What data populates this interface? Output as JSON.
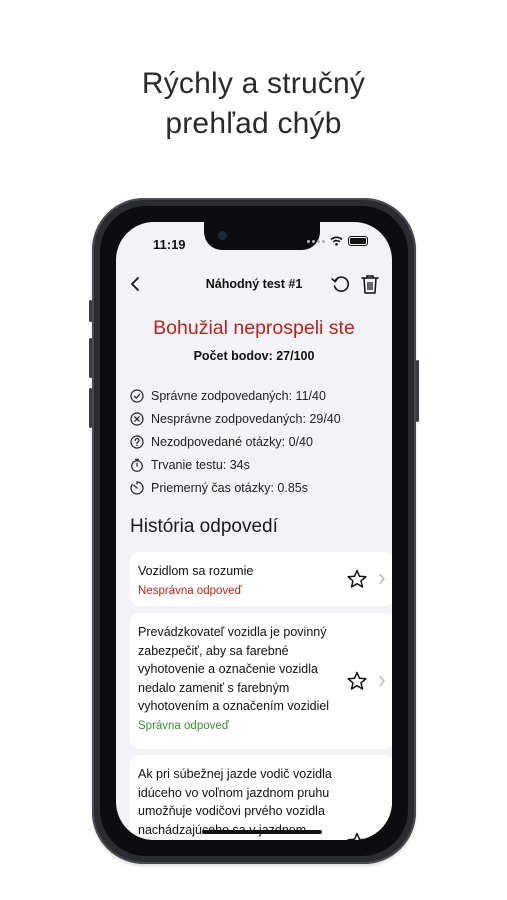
{
  "headline": {
    "line1": "Rýchly a stručný",
    "line2": "prehľad chýb"
  },
  "status_bar": {
    "time": "11:19"
  },
  "nav": {
    "title": "Náhodný test #1"
  },
  "result": {
    "title": "Bohužial neprospeli ste",
    "score": "Počet bodov: 27/100"
  },
  "stats": [
    {
      "icon": "check-circle-icon",
      "text": "Správne zodpovedaných: 11/40"
    },
    {
      "icon": "x-circle-icon",
      "text": "Nesprávne zodpovedaných: 29/40"
    },
    {
      "icon": "question-circle-icon",
      "text": "Nezodpovedané otázky: 0/40"
    },
    {
      "icon": "stopwatch-icon",
      "text": "Trvanie testu: 34s"
    },
    {
      "icon": "timer-icon",
      "text": "Priemerný čas otázky: 0.85s"
    }
  ],
  "history": {
    "title": "História odpovedí",
    "items": [
      {
        "question": "Vozidlom sa rozumie",
        "status": "Nesprávna odpoveď",
        "correct": false
      },
      {
        "question": "Prevádzkovateľ vozidla je povinný zabezpečiť, aby sa farebné vyhotovenie a označenie vozidla nedalo zameniť s farebným vyhotovením a označením vozidiel",
        "status": "Správna odpoveď",
        "correct": true
      },
      {
        "question": "Ak pri súbežnej jazde vodič vozidla idúceho vo voľnom jazdnom pruhu umožňuje vodičovi prvého vozidla nachádzajúceho sa v jazdnom pruhu, ktorý sa zapojuje, aby",
        "status": "",
        "correct": null
      }
    ]
  },
  "colors": {
    "error": "#b3261e",
    "success": "#3f8c3a",
    "background": "#f2f2f7"
  }
}
